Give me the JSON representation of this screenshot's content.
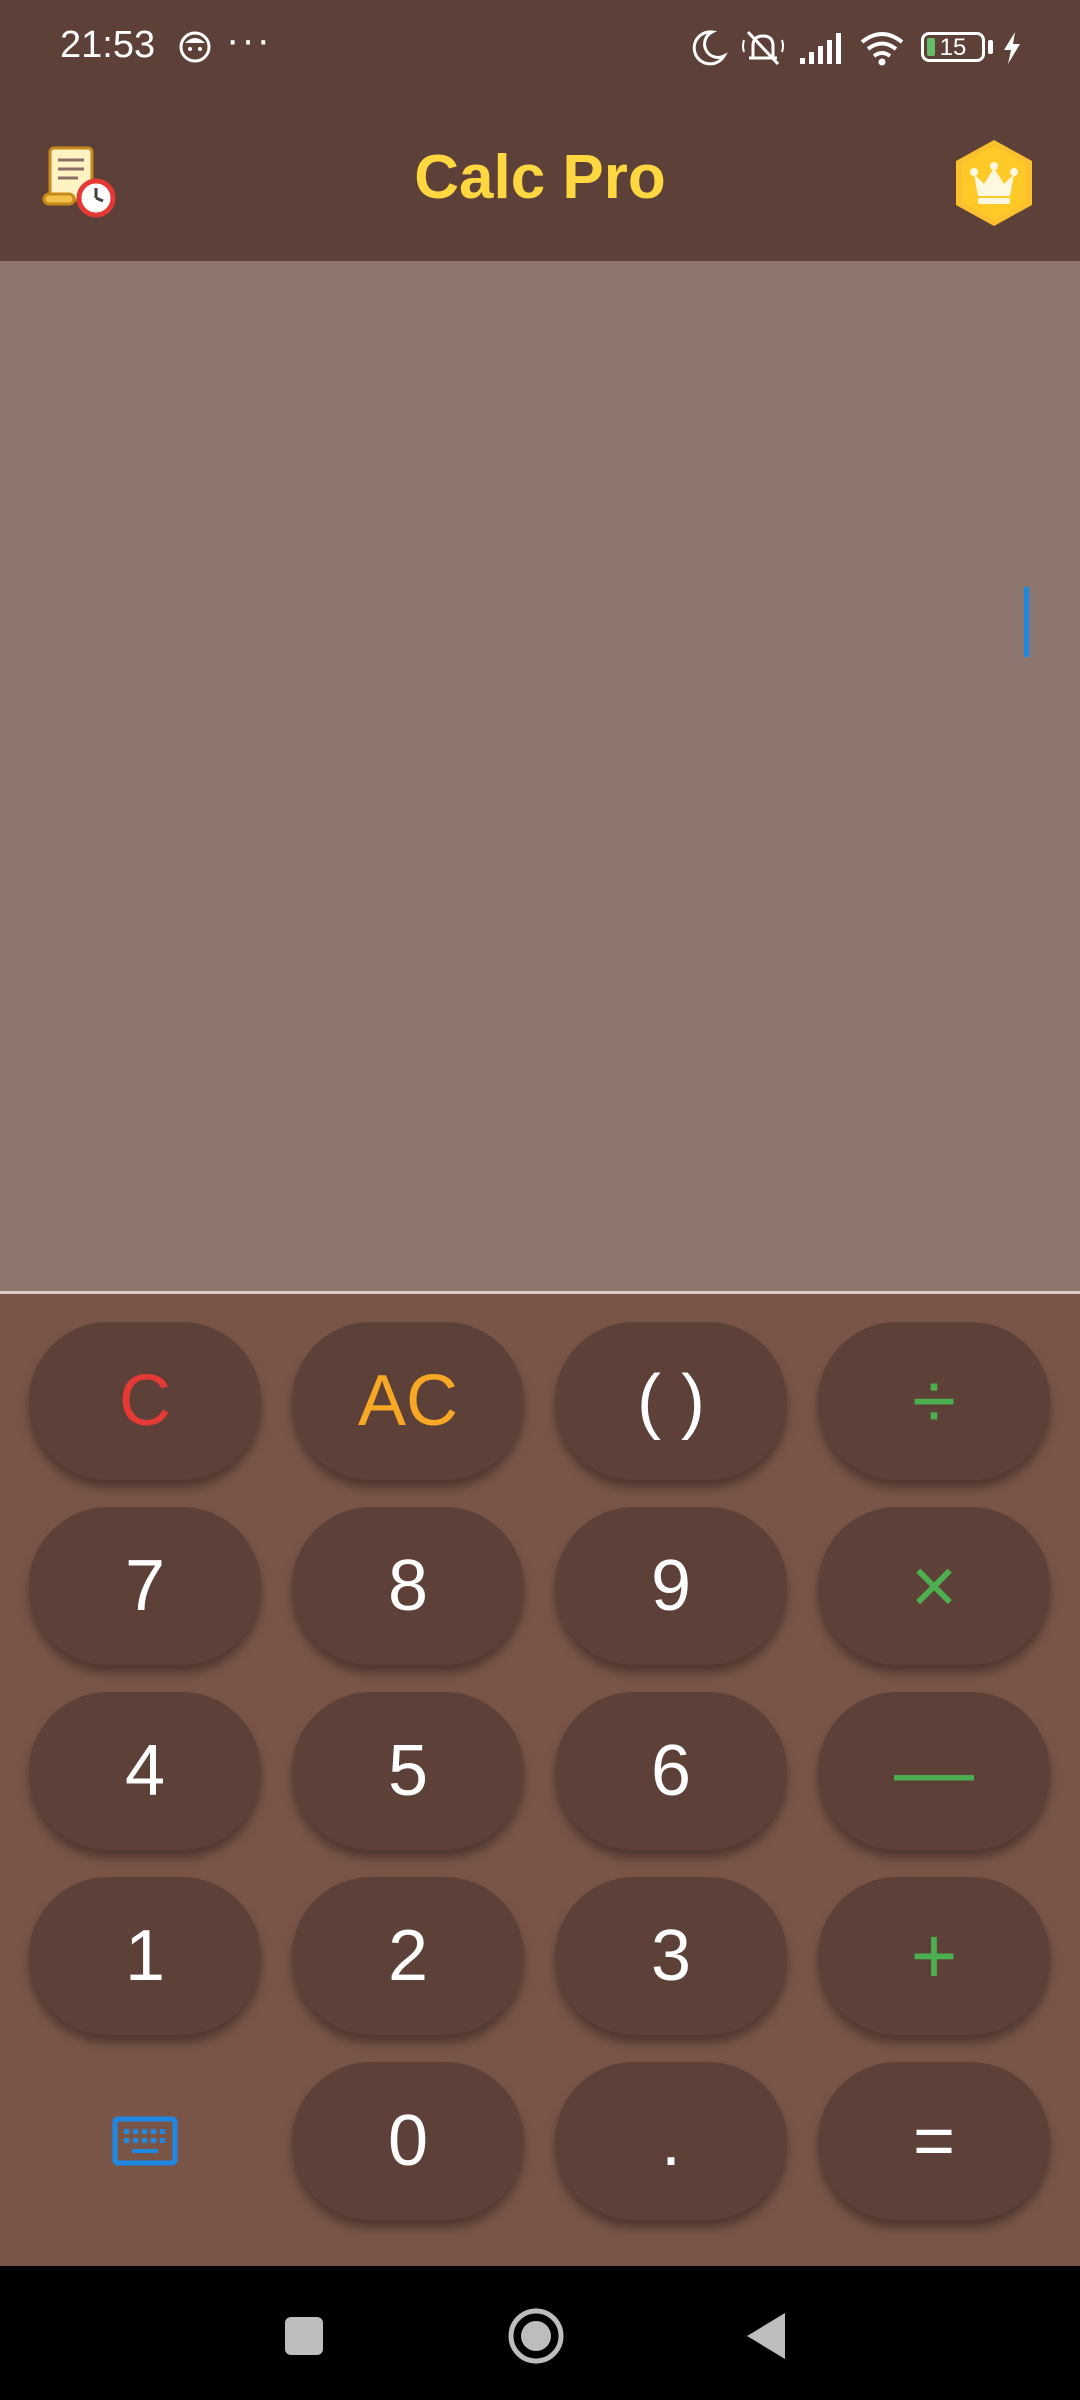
{
  "status_bar": {
    "time": "21:53",
    "overflow_dots": "···",
    "battery_level": "15",
    "icons": [
      "face-icon",
      "moon-icon",
      "mute-icon",
      "signal-icon",
      "wifi-icon",
      "battery-icon",
      "charging-icon"
    ]
  },
  "app_bar": {
    "title": "Calc Pro",
    "left_icon": "history-scroll-icon",
    "right_icon": "premium-crown-icon",
    "title_color": "#ffd740"
  },
  "display": {
    "expression": "",
    "caret_color": "#1e88e5"
  },
  "keypad": {
    "row1": [
      "C",
      "AC",
      "( )",
      "÷"
    ],
    "row2": [
      "7",
      "8",
      "9",
      "×"
    ],
    "row3": [
      "4",
      "5",
      "6",
      "—"
    ],
    "row4": [
      "1",
      "2",
      "3",
      "+"
    ],
    "row5": [
      "0",
      ".",
      "="
    ],
    "keyboard_toggle_icon": "keyboard-icon",
    "colors": {
      "clear": "#e53935",
      "all_clear": "#f9a825",
      "operator": "#4caf50",
      "digit": "#ffffff"
    }
  },
  "nav_bar": {
    "icons": [
      "recents-square-icon",
      "home-circle-icon",
      "back-triangle-icon"
    ]
  }
}
